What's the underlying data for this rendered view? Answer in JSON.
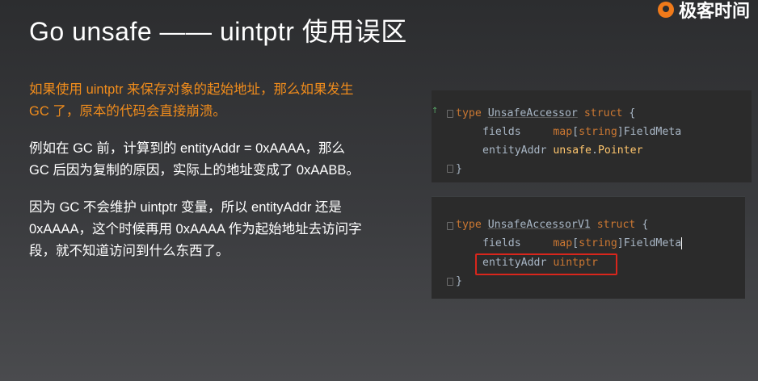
{
  "slide": {
    "title": "Go unsafe —— uintptr 使用误区",
    "logo_text": "极客时间"
  },
  "paragraphs": [
    {
      "text": "如果使用 uintptr 来保存对象的起始地址，那么如果发生 GC 了，原本的代码会直接崩溃。",
      "highlight": true
    },
    {
      "text": "例如在 GC 前，计算到的 entityAddr = 0xAAAA，那么 GC 后因为复制的原因，实际上的地址变成了 0xAABB。",
      "highlight": false
    },
    {
      "text": "因为 GC 不会维护 uintptr 变量，所以 entityAddr 还是0xAAAA，这个时候再用 0xAAAA 作为起始地址去访问字段，就不知道访问到什么东西了。",
      "highlight": false
    }
  ],
  "code1": {
    "kw_type": "type",
    "name": "UnsafeAccessor",
    "kw_struct": "struct",
    "open": "{",
    "close": "}",
    "f1_name": "fields",
    "f1_map": "map",
    "f1_lb": "[",
    "f1_key": "string",
    "f1_rb": "]",
    "f1_val": "FieldMeta",
    "f2_name": "entityAddr",
    "f2_pkg": "unsafe",
    "f2_dot": ".",
    "f2_type": "Pointer"
  },
  "code2": {
    "kw_type": "type",
    "name": "UnsafeAccessorV1",
    "kw_struct": "struct",
    "open": "{",
    "close": "}",
    "f1_name": "fields",
    "f1_map": "map",
    "f1_lb": "[",
    "f1_key": "string",
    "f1_rb": "]",
    "f1_val": "FieldMeta",
    "f2_name": "entityAddr",
    "f2_type": "uintptr"
  },
  "colors": {
    "highlight_text": "#f08c1c",
    "code_bg": "#2b2b2b",
    "keyword": "#cc7832",
    "red_box": "#d9261c"
  }
}
